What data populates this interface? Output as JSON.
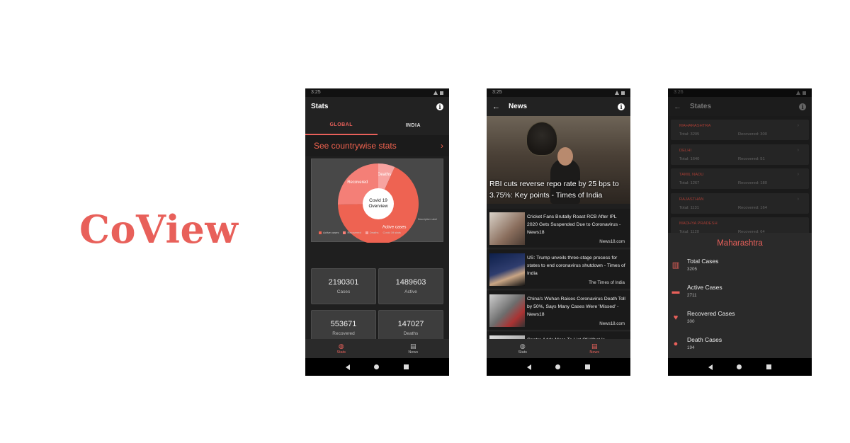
{
  "brand": {
    "name": "CoView",
    "color": "#e8605a"
  },
  "phone1": {
    "status": {
      "time": "3:25"
    },
    "appbar_title": "Stats",
    "tabs": [
      {
        "label": "GLOBAL",
        "active": true
      },
      {
        "label": "INDIA",
        "active": false
      }
    ],
    "country_link": "See countrywise stats",
    "chart_data": {
      "type": "pie",
      "center_label_line1": "Covid 19",
      "center_label_line2": "Overview",
      "slices": [
        {
          "label": "Active cases",
          "value": 1489603,
          "color": "#ee6352"
        },
        {
          "label": "Recovered",
          "value": 553671,
          "color": "#f47f77"
        },
        {
          "label": "Deaths",
          "value": 147027,
          "color": "#f7a3a0"
        }
      ],
      "legend": [
        "Active cases",
        "Recovered",
        "Deaths"
      ],
      "legend_suffix": "Covid 19 stats",
      "description": "Description Label"
    },
    "stats": [
      {
        "value": "2190301",
        "label": "Cases"
      },
      {
        "value": "1489603",
        "label": "Active"
      },
      {
        "value": "553671",
        "label": "Recovered"
      },
      {
        "value": "147027",
        "label": "Deaths"
      }
    ],
    "nav": [
      {
        "label": "Stats",
        "active": true
      },
      {
        "label": "News",
        "active": false
      }
    ]
  },
  "phone2": {
    "status": {
      "time": "3:25"
    },
    "appbar_title": "News",
    "hero_title": "RBI cuts reverse repo rate by 25 bps to 3.75%: Key points - Times of India",
    "news": [
      {
        "title": "Cricket Fans Brutally Roast RCB After IPL 2020 Gets Suspended Due to Coronavirus - News18",
        "source": "News18.com"
      },
      {
        "title": "US: Trump unveils three-stage process for states to end coronavirus shutdown - Times of India",
        "source": "The Times of India"
      },
      {
        "title": "China's Wuhan Raises Coronavirus Death Toll by 50%, Says Many Cases Were 'Missed' - News18",
        "source": "News18.com"
      },
      {
        "title": "Centre Adds More To List Of What Is",
        "source": ""
      }
    ],
    "nav": [
      {
        "label": "Stats",
        "active": false
      },
      {
        "label": "News",
        "active": true
      }
    ]
  },
  "phone3": {
    "status": {
      "time": "3:26"
    },
    "appbar_title": "States",
    "states": [
      {
        "name": "MAHARASHTRA",
        "total": "Total: 3205",
        "recovered": "Recovered: 300"
      },
      {
        "name": "DELHI",
        "total": "Total: 1640",
        "recovered": "Recovered: 51"
      },
      {
        "name": "TAMIL NADU",
        "total": "Total: 1267",
        "recovered": "Recovered: 180"
      },
      {
        "name": "RAJASTHAN",
        "total": "Total: 1131",
        "recovered": "Recovered: 164"
      },
      {
        "name": "MADHYA PRADESH",
        "total": "Total: 1120",
        "recovered": "Recovered: 64"
      }
    ],
    "sheet": {
      "title": "Maharashtra",
      "rows": [
        {
          "label": "Total Cases",
          "value": "3205",
          "icon": "bar-chart-icon"
        },
        {
          "label": "Active Cases",
          "value": "2711",
          "icon": "bed-icon"
        },
        {
          "label": "Recovered Cases",
          "value": "300",
          "icon": "heart-icon"
        },
        {
          "label": "Death Cases",
          "value": "194",
          "icon": "virus-icon"
        }
      ]
    }
  }
}
